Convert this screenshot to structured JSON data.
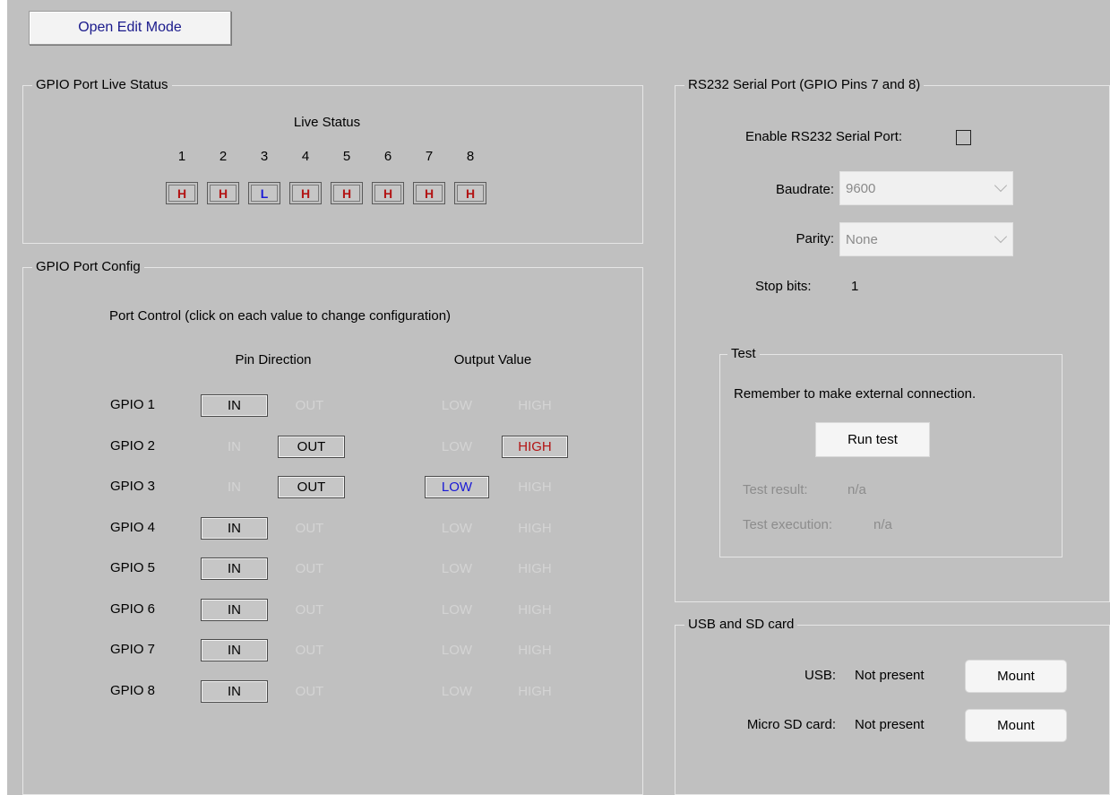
{
  "toolbar": {
    "open_edit_mode": "Open Edit Mode"
  },
  "live": {
    "title": "GPIO Port Live Status",
    "heading": "Live Status",
    "pins": [
      {
        "n": "1",
        "v": "H"
      },
      {
        "n": "2",
        "v": "H"
      },
      {
        "n": "3",
        "v": "L"
      },
      {
        "n": "4",
        "v": "H"
      },
      {
        "n": "5",
        "v": "H"
      },
      {
        "n": "6",
        "v": "H"
      },
      {
        "n": "7",
        "v": "H"
      },
      {
        "n": "8",
        "v": "H"
      }
    ]
  },
  "config": {
    "title": "GPIO Port Config",
    "instruction": "Port Control (click on each value to change configuration)",
    "pin_direction_header": "Pin Direction",
    "output_value_header": "Output Value",
    "rows": [
      {
        "label": "GPIO 1",
        "in": "IN",
        "out": "OUT",
        "low": "LOW",
        "high": "HIGH",
        "dir": "IN",
        "val": null
      },
      {
        "label": "GPIO 2",
        "in": "IN",
        "out": "OUT",
        "low": "LOW",
        "high": "HIGH",
        "dir": "OUT",
        "val": "HIGH"
      },
      {
        "label": "GPIO 3",
        "in": "IN",
        "out": "OUT",
        "low": "LOW",
        "high": "HIGH",
        "dir": "OUT",
        "val": "LOW"
      },
      {
        "label": "GPIO 4",
        "in": "IN",
        "out": "OUT",
        "low": "LOW",
        "high": "HIGH",
        "dir": "IN",
        "val": null
      },
      {
        "label": "GPIO 5",
        "in": "IN",
        "out": "OUT",
        "low": "LOW",
        "high": "HIGH",
        "dir": "IN",
        "val": null
      },
      {
        "label": "GPIO 6",
        "in": "IN",
        "out": "OUT",
        "low": "LOW",
        "high": "HIGH",
        "dir": "IN",
        "val": null
      },
      {
        "label": "GPIO 7",
        "in": "IN",
        "out": "OUT",
        "low": "LOW",
        "high": "HIGH",
        "dir": "IN",
        "val": null
      },
      {
        "label": "GPIO 8",
        "in": "IN",
        "out": "OUT",
        "low": "LOW",
        "high": "HIGH",
        "dir": "IN",
        "val": null
      }
    ]
  },
  "serial": {
    "title": "RS232 Serial Port (GPIO Pins 7 and 8)",
    "enable_label": "Enable RS232 Serial Port:",
    "enabled": false,
    "baudrate_label": "Baudrate:",
    "baudrate_value": "9600",
    "parity_label": "Parity:",
    "parity_value": "None",
    "stopbits_label": "Stop bits:",
    "stopbits_value": "1",
    "test": {
      "title": "Test",
      "note": "Remember to make external connection.",
      "run_button": "Run test",
      "result_label": "Test result:",
      "result_value": "n/a",
      "execution_label": "Test execution:",
      "execution_value": "n/a"
    }
  },
  "storage": {
    "title": "USB and SD card",
    "usb_label": "USB:",
    "usb_status": "Not present",
    "usb_button": "Mount",
    "sd_label": "Micro SD card:",
    "sd_status": "Not present",
    "sd_button": "Mount"
  },
  "colors": {
    "panel_bg": "#c0c0c0",
    "high_text": "#b31414",
    "low_text": "#1a1ad6",
    "disabled_text": "#d4d4d4"
  }
}
